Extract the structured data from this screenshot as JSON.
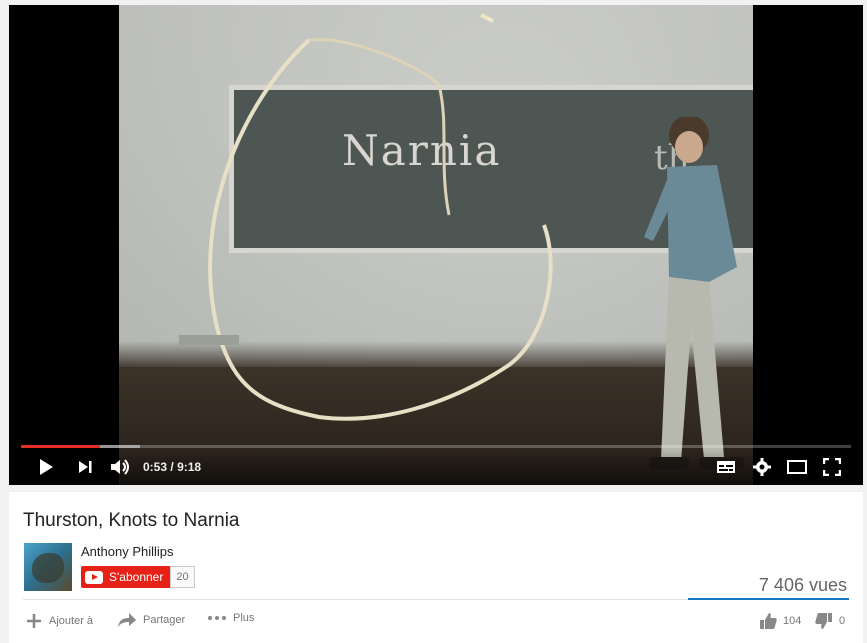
{
  "player": {
    "time_current": "0:53",
    "time_separator": "/",
    "time_total": "9:18",
    "progress_played": 0.095,
    "progress_buffered": 0.143,
    "board_text": "Narnia",
    "board_text_partial": "th",
    "accent_color": "#e52d27"
  },
  "video": {
    "title": "Thurston, Knots to Narnia",
    "channel_name": "Anthony Phillips",
    "subscribe_label": "S'abonner",
    "subscriber_count": "20",
    "views": "7 406 vues"
  },
  "actions": {
    "add_to_label": "Ajouter à",
    "share_label": "Partager",
    "more_label": "Plus",
    "like_count": "104",
    "dislike_count": "0"
  },
  "icons": [
    "play-icon",
    "next-icon",
    "volume-icon",
    "subtitles-icon",
    "settings-icon",
    "theater-icon",
    "fullscreen-icon",
    "plus-icon",
    "share-icon",
    "more-icon",
    "thumbs-up-icon",
    "thumbs-down-icon"
  ]
}
